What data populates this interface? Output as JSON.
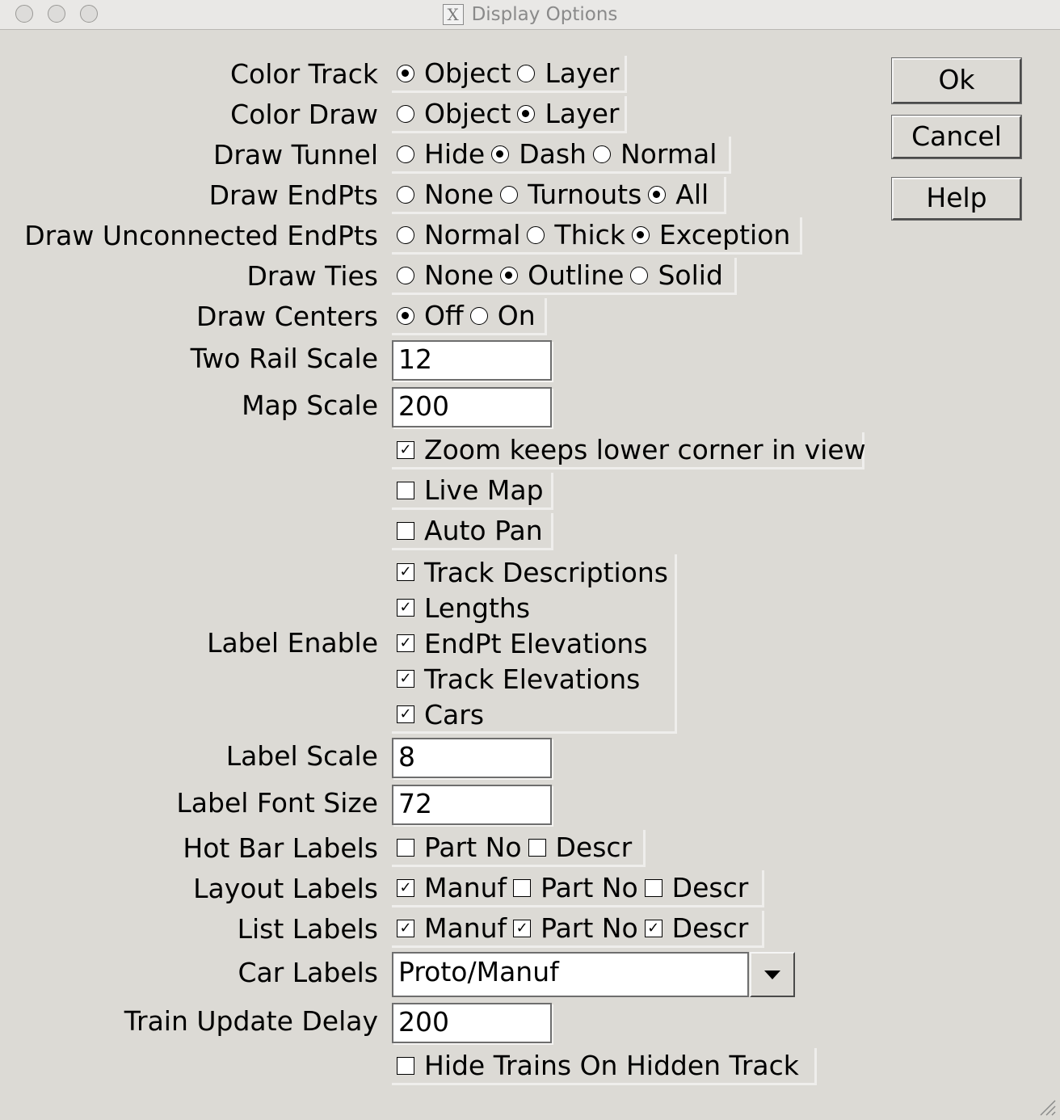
{
  "window": {
    "title": "Display Options",
    "app_icon": "x11-logo-icon",
    "x_glyph": "X"
  },
  "buttons": {
    "ok": "Ok",
    "cancel": "Cancel",
    "help": "Help"
  },
  "radio_rows": [
    {
      "label": "Color Track",
      "options": [
        {
          "text": "Object",
          "selected": true
        },
        {
          "text": "Layer",
          "selected": false
        }
      ]
    },
    {
      "label": "Color Draw",
      "options": [
        {
          "text": "Object",
          "selected": false
        },
        {
          "text": "Layer",
          "selected": true
        }
      ]
    },
    {
      "label": "Draw Tunnel",
      "options": [
        {
          "text": "Hide",
          "selected": false
        },
        {
          "text": "Dash",
          "selected": true
        },
        {
          "text": "Normal",
          "selected": false
        }
      ]
    },
    {
      "label": "Draw EndPts",
      "options": [
        {
          "text": "None",
          "selected": false
        },
        {
          "text": "Turnouts",
          "selected": false
        },
        {
          "text": "All",
          "selected": true
        }
      ]
    },
    {
      "label": "Draw Unconnected EndPts",
      "options": [
        {
          "text": "Normal",
          "selected": false
        },
        {
          "text": "Thick",
          "selected": false
        },
        {
          "text": "Exception",
          "selected": true
        }
      ]
    },
    {
      "label": "Draw Ties",
      "options": [
        {
          "text": "None",
          "selected": false
        },
        {
          "text": "Outline",
          "selected": true
        },
        {
          "text": "Solid",
          "selected": false
        }
      ]
    },
    {
      "label": "Draw Centers",
      "options": [
        {
          "text": "Off",
          "selected": true
        },
        {
          "text": "On",
          "selected": false
        }
      ]
    }
  ],
  "two_rail_scale": {
    "label": "Two Rail Scale",
    "value": "12"
  },
  "map_scale": {
    "label": "Map Scale",
    "value": "200"
  },
  "zoom_keeps": {
    "text": "Zoom keeps lower corner in view",
    "checked": true
  },
  "live_map": {
    "text": "Live Map",
    "checked": false
  },
  "auto_pan": {
    "text": "Auto Pan",
    "checked": false
  },
  "label_enable": {
    "label": "Label Enable",
    "items": [
      {
        "text": "Track Descriptions",
        "checked": true
      },
      {
        "text": "Lengths",
        "checked": true
      },
      {
        "text": "EndPt Elevations",
        "checked": true
      },
      {
        "text": "Track Elevations",
        "checked": true
      },
      {
        "text": "Cars",
        "checked": true
      }
    ]
  },
  "label_scale": {
    "label": "Label Scale",
    "value": "8"
  },
  "label_font_size": {
    "label": "Label Font Size",
    "value": "72"
  },
  "check_rows": [
    {
      "label": "Hot Bar Labels",
      "options": [
        {
          "text": "Part No",
          "checked": false
        },
        {
          "text": "Descr",
          "checked": false
        }
      ]
    },
    {
      "label": "Layout Labels",
      "options": [
        {
          "text": "Manuf",
          "checked": true
        },
        {
          "text": "Part No",
          "checked": false
        },
        {
          "text": "Descr",
          "checked": false
        }
      ]
    },
    {
      "label": "List Labels",
      "options": [
        {
          "text": "Manuf",
          "checked": true
        },
        {
          "text": "Part No",
          "checked": true
        },
        {
          "text": "Descr",
          "checked": true
        }
      ]
    }
  ],
  "car_labels": {
    "label": "Car Labels",
    "value": "Proto/Manuf"
  },
  "train_update_delay": {
    "label": "Train Update Delay",
    "value": "200"
  },
  "hide_trains": {
    "text": "Hide Trains On Hidden Track",
    "checked": false
  },
  "checkmark_glyph": "✓"
}
